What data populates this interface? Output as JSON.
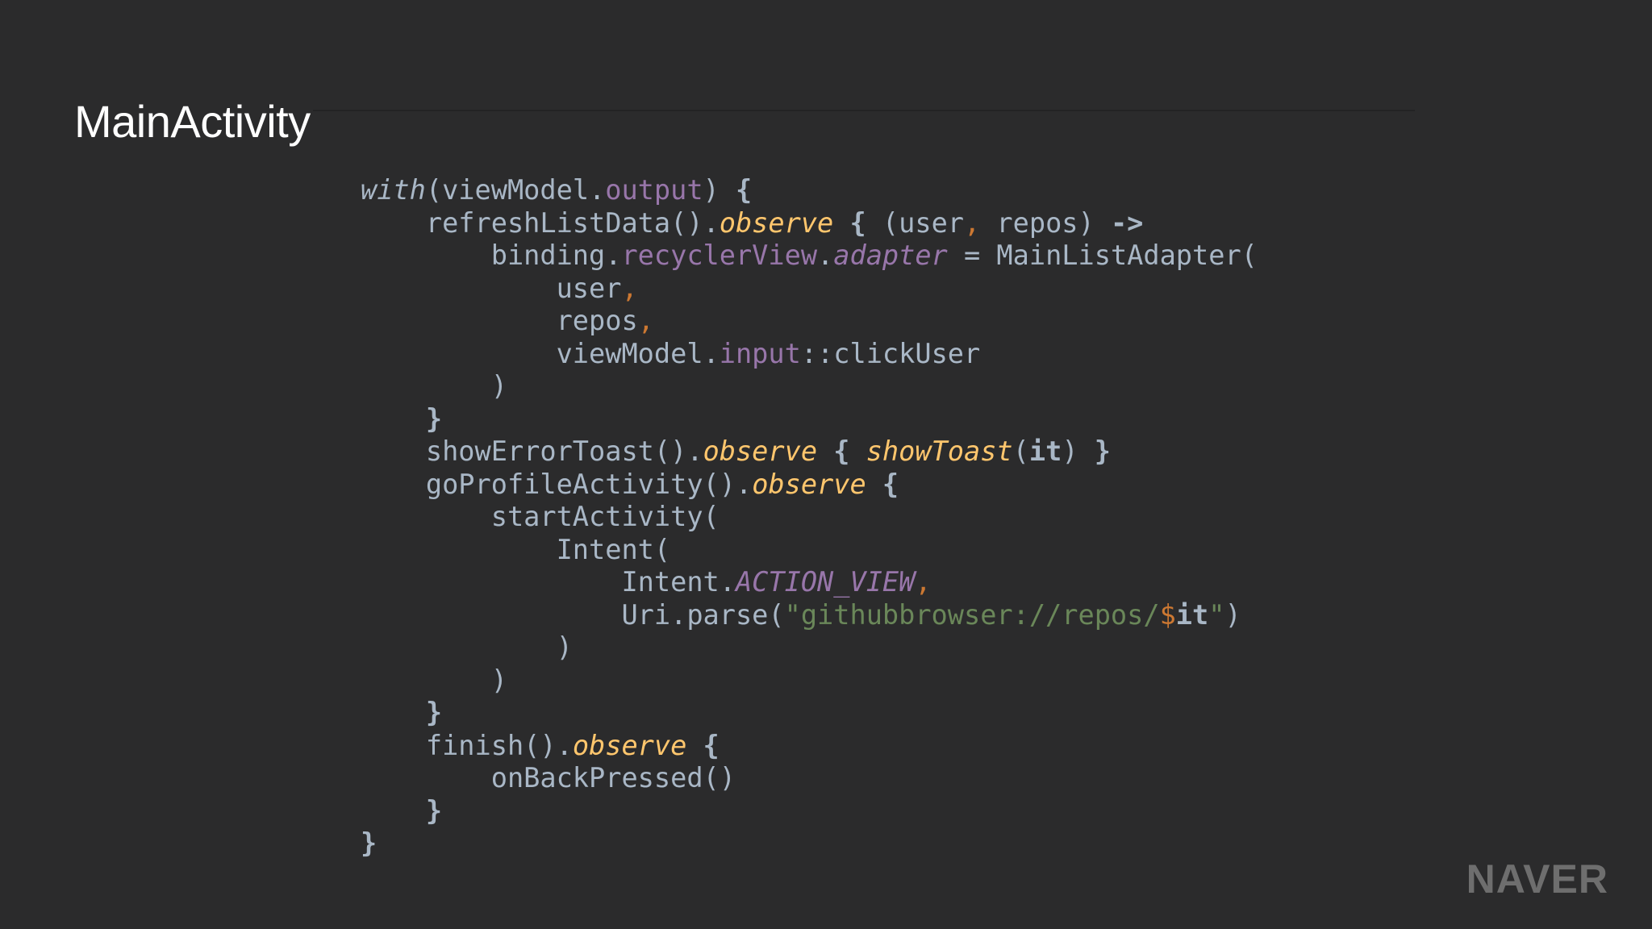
{
  "slide": {
    "title": "MainActivity",
    "logo": "NAVER"
  },
  "code": {
    "language": "Kotlin",
    "lines": [
      [
        {
          "t": "with",
          "s": "italic-plain"
        },
        {
          "t": "(viewModel.",
          "s": "plain"
        },
        {
          "t": "output",
          "s": "prop"
        },
        {
          "t": ") ",
          "s": "plain"
        },
        {
          "t": "{",
          "s": "bold"
        }
      ],
      [
        {
          "t": "    refreshListData().",
          "s": "plain"
        },
        {
          "t": "observe",
          "s": "fn-italic"
        },
        {
          "t": " ",
          "s": "plain"
        },
        {
          "t": "{",
          "s": "bold"
        },
        {
          "t": " (user",
          "s": "plain"
        },
        {
          "t": ",",
          "s": "comma"
        },
        {
          "t": " repos) ",
          "s": "plain"
        },
        {
          "t": "->",
          "s": "bold"
        }
      ],
      [
        {
          "t": "        binding.",
          "s": "plain"
        },
        {
          "t": "recyclerView",
          "s": "prop"
        },
        {
          "t": ".",
          "s": "plain"
        },
        {
          "t": "adapter",
          "s": "prop-italic"
        },
        {
          "t": " = MainListAdapter(",
          "s": "plain"
        }
      ],
      [
        {
          "t": "            user",
          "s": "plain"
        },
        {
          "t": ",",
          "s": "comma"
        }
      ],
      [
        {
          "t": "            repos",
          "s": "plain"
        },
        {
          "t": ",",
          "s": "comma"
        }
      ],
      [
        {
          "t": "            viewModel.",
          "s": "plain"
        },
        {
          "t": "input",
          "s": "prop"
        },
        {
          "t": "::clickUser",
          "s": "plain"
        }
      ],
      [
        {
          "t": "        )",
          "s": "plain"
        }
      ],
      [
        {
          "t": "    ",
          "s": "plain"
        },
        {
          "t": "}",
          "s": "bold"
        }
      ],
      [
        {
          "t": "    showErrorToast().",
          "s": "plain"
        },
        {
          "t": "observe",
          "s": "fn-italic"
        },
        {
          "t": " ",
          "s": "plain"
        },
        {
          "t": "{",
          "s": "bold"
        },
        {
          "t": " ",
          "s": "plain"
        },
        {
          "t": "showToast",
          "s": "fn-italic"
        },
        {
          "t": "(",
          "s": "plain"
        },
        {
          "t": "it",
          "s": "bold"
        },
        {
          "t": ") ",
          "s": "plain"
        },
        {
          "t": "}",
          "s": "bold"
        }
      ],
      [
        {
          "t": "    goProfileActivity().",
          "s": "plain"
        },
        {
          "t": "observe",
          "s": "fn-italic"
        },
        {
          "t": " ",
          "s": "plain"
        },
        {
          "t": "{",
          "s": "bold"
        }
      ],
      [
        {
          "t": "        startActivity(",
          "s": "plain"
        }
      ],
      [
        {
          "t": "            Intent(",
          "s": "plain"
        }
      ],
      [
        {
          "t": "                Intent.",
          "s": "plain"
        },
        {
          "t": "ACTION_VIEW",
          "s": "prop-italic"
        },
        {
          "t": ",",
          "s": "comma"
        }
      ],
      [
        {
          "t": "                Uri.parse(",
          "s": "plain"
        },
        {
          "t": "\"githubbrowser://repos/",
          "s": "string"
        },
        {
          "t": "$",
          "s": "tmpl"
        },
        {
          "t": "it",
          "s": "bold"
        },
        {
          "t": "\"",
          "s": "string"
        },
        {
          "t": ")",
          "s": "plain"
        }
      ],
      [
        {
          "t": "            )",
          "s": "plain"
        }
      ],
      [
        {
          "t": "        )",
          "s": "plain"
        }
      ],
      [
        {
          "t": "    ",
          "s": "plain"
        },
        {
          "t": "}",
          "s": "bold"
        }
      ],
      [
        {
          "t": "    finish().",
          "s": "plain"
        },
        {
          "t": "observe",
          "s": "fn-italic"
        },
        {
          "t": " ",
          "s": "plain"
        },
        {
          "t": "{",
          "s": "bold"
        }
      ],
      [
        {
          "t": "        onBackPressed()",
          "s": "plain"
        }
      ],
      [
        {
          "t": "    ",
          "s": "plain"
        },
        {
          "t": "}",
          "s": "bold"
        }
      ],
      [
        {
          "t": "}",
          "s": "bold"
        }
      ]
    ]
  },
  "colors": {
    "background": "#2b2b2c",
    "plain": "#a9b7c6",
    "property": "#9876aa",
    "function": "#ffc66d",
    "keyword_comma": "#cc7832",
    "string": "#6a8759",
    "logo": "#6e6e6e"
  }
}
